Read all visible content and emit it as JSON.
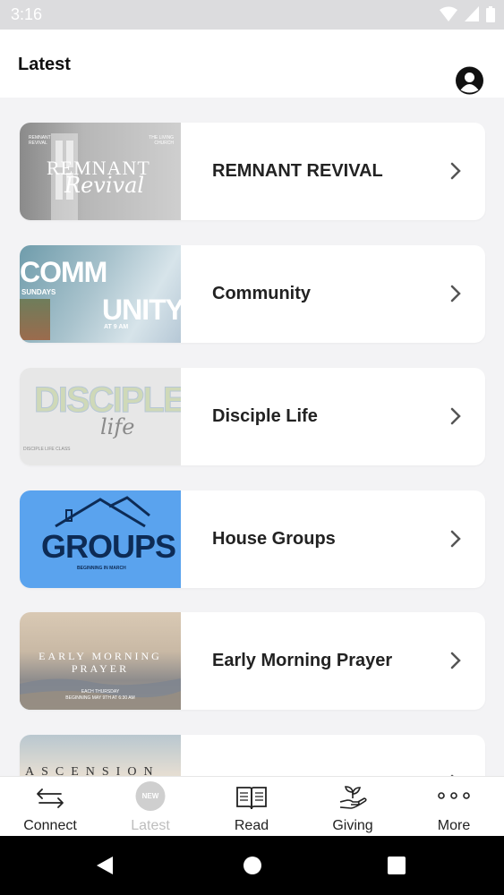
{
  "status_bar": {
    "time": "3:16"
  },
  "header": {
    "title": "Latest"
  },
  "items": [
    {
      "label": "REMNANT REVIVAL",
      "thumb_title": "REMNANT",
      "thumb_sub": "Revival",
      "thumb_corner_left": "REMNANT REVIVAL",
      "thumb_corner_right": "THE LIVING CHURCH"
    },
    {
      "label": "Community",
      "thumb_line1": "COMM",
      "thumb_line2": "UNITY",
      "thumb_sundays": "SUNDAYS",
      "thumb_time": "AT 9 AM"
    },
    {
      "label": "Disciple Life",
      "thumb_title": "DISCIPLE",
      "thumb_sub": "life",
      "thumb_small": "DISCIPLE LIFE CLASS"
    },
    {
      "label": "House Groups",
      "thumb_title": "GROUPS",
      "thumb_sub": "BEGINNING IN MARCH"
    },
    {
      "label": "Early Morning Prayer",
      "thumb_title": "EARLY MORNING",
      "thumb_title2": "PRAYER",
      "thumb_sub": "EACH THURSDAY",
      "thumb_sub2": "BEGINNING MAY 9TH AT 6:30 AM"
    },
    {
      "label": "",
      "thumb_title": "ASCENSION"
    }
  ],
  "tabs": [
    {
      "label": "Connect",
      "icon": "connect-arrows-icon"
    },
    {
      "label": "Latest",
      "badge": "NEW",
      "icon": "new-badge-icon"
    },
    {
      "label": "Read",
      "icon": "book-icon"
    },
    {
      "label": "Giving",
      "icon": "giving-hand-icon"
    },
    {
      "label": "More",
      "icon": "more-dots-icon"
    }
  ],
  "colors": {
    "accent": "#111111",
    "inactive": "#bdbdbd",
    "groups_blue": "#5aa3ee"
  }
}
